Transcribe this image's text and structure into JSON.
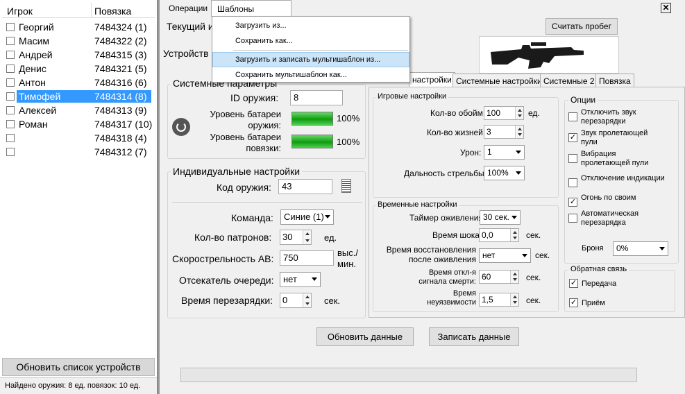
{
  "left_panel": {
    "col_player": "Игрок",
    "col_band": "Повязка",
    "players": [
      {
        "name": "Георгий",
        "band": "7484324 (1)"
      },
      {
        "name": "Масим",
        "band": "7484322 (2)"
      },
      {
        "name": "Андрей",
        "band": "7484315 (3)"
      },
      {
        "name": "Денис",
        "band": "7484321 (5)"
      },
      {
        "name": "Антон",
        "band": "7484316 (6)"
      },
      {
        "name": "Тимофей",
        "band": "7484314 (8)"
      },
      {
        "name": "Алексей",
        "band": "7484313 (9)"
      },
      {
        "name": "Роман",
        "band": "7484317 (10)"
      },
      {
        "name": "",
        "band": "7484318 (4)"
      },
      {
        "name": "",
        "band": "7484312 (7)"
      }
    ],
    "refresh_button": "Обновить список устройств",
    "status": "Найдено оружия: 8 ед. повязок: 10 ед."
  },
  "menu": {
    "operations": "Операции",
    "templates": "Шаблоны настроек",
    "dropdown": [
      "Загрузить из...",
      "Сохранить как...",
      "Загрузить и записать мультишаблон из...",
      "Сохранить мультишаблон как..."
    ]
  },
  "top": {
    "current_label": "Текущий и",
    "read_mileage": "Считать пробег",
    "device_label": "Устройств"
  },
  "tabs": [
    "настройки",
    "Системные настройки",
    "Системные 2",
    "Повязка"
  ],
  "system_params": {
    "title": "Системные параметры",
    "weapon_id_label": "ID оружия:",
    "weapon_id": "8",
    "weapon_battery_label": "Уровень батареи оружия:",
    "weapon_battery_pct": "100%",
    "band_battery_label": "Уровень батареи повязки:",
    "band_battery_pct": "100%"
  },
  "individual": {
    "title": "Индивидуальные настройки",
    "code_label": "Код оружия:",
    "code": "43",
    "team_label": "Команда:",
    "team": "Синие (1)",
    "ammo_label": "Кол-во патронов:",
    "ammo": "30",
    "ammo_unit": "ед.",
    "rate_label": "Скорострельность АВ:",
    "rate": "750",
    "rate_unit_1": "выс./",
    "rate_unit_2": "мин.",
    "cutoff_label": "Отсекатель очереди:",
    "cutoff": "нет",
    "reload_label": "Время перезарядки:",
    "reload": "0",
    "reload_unit": "сек."
  },
  "game": {
    "title": "Игровые настройки",
    "clips_label": "Кол-во обойм:",
    "clips": "100",
    "clips_unit": "ед.",
    "lives_label": "Кол-во жизней:",
    "lives": "3",
    "damage_label": "Урон:",
    "damage": "1",
    "range_label": "Дальность стрельбы:",
    "range": "100%"
  },
  "time": {
    "title": "Временные настройки",
    "revive_label": "Таймер оживления",
    "revive": "30 сек.",
    "shock_label": "Время шока",
    "shock": "0,0",
    "shock_unit": "сек.",
    "restore_label_1": "Время восстановления",
    "restore_label_2": "после оживления",
    "restore": "нет",
    "restore_unit": "сек.",
    "death_label_1": "Время откл-я",
    "death_label_2": "сигнала смерти:",
    "death": "60",
    "death_unit": "сек.",
    "invuln_label_1": "Время",
    "invuln_label_2": "неуязвимости",
    "invuln": "1,5",
    "invuln_unit": "сек."
  },
  "options": {
    "title": "Опции",
    "items": [
      {
        "label_1": "Отключить звук",
        "label_2": "перезарядки",
        "checked": false
      },
      {
        "label_1": "Звук пролетающей",
        "label_2": "пули",
        "checked": true
      },
      {
        "label_1": "Вибрация",
        "label_2": "пролетающей пули",
        "checked": false
      },
      {
        "label_1": "Отключение индикации",
        "label_2": "",
        "checked": false
      },
      {
        "label_1": "Огонь по своим",
        "label_2": "",
        "checked": true
      },
      {
        "label_1": "Автоматическая",
        "label_2": "перезарядка",
        "checked": false
      }
    ],
    "armor_label": "Броня",
    "armor": "0%"
  },
  "feedback": {
    "title": "Обратная связь",
    "transmit": "Передача",
    "receive": "Приём"
  },
  "actions": {
    "update": "Обновить данные",
    "write": "Записать данные"
  },
  "progress": 0
}
